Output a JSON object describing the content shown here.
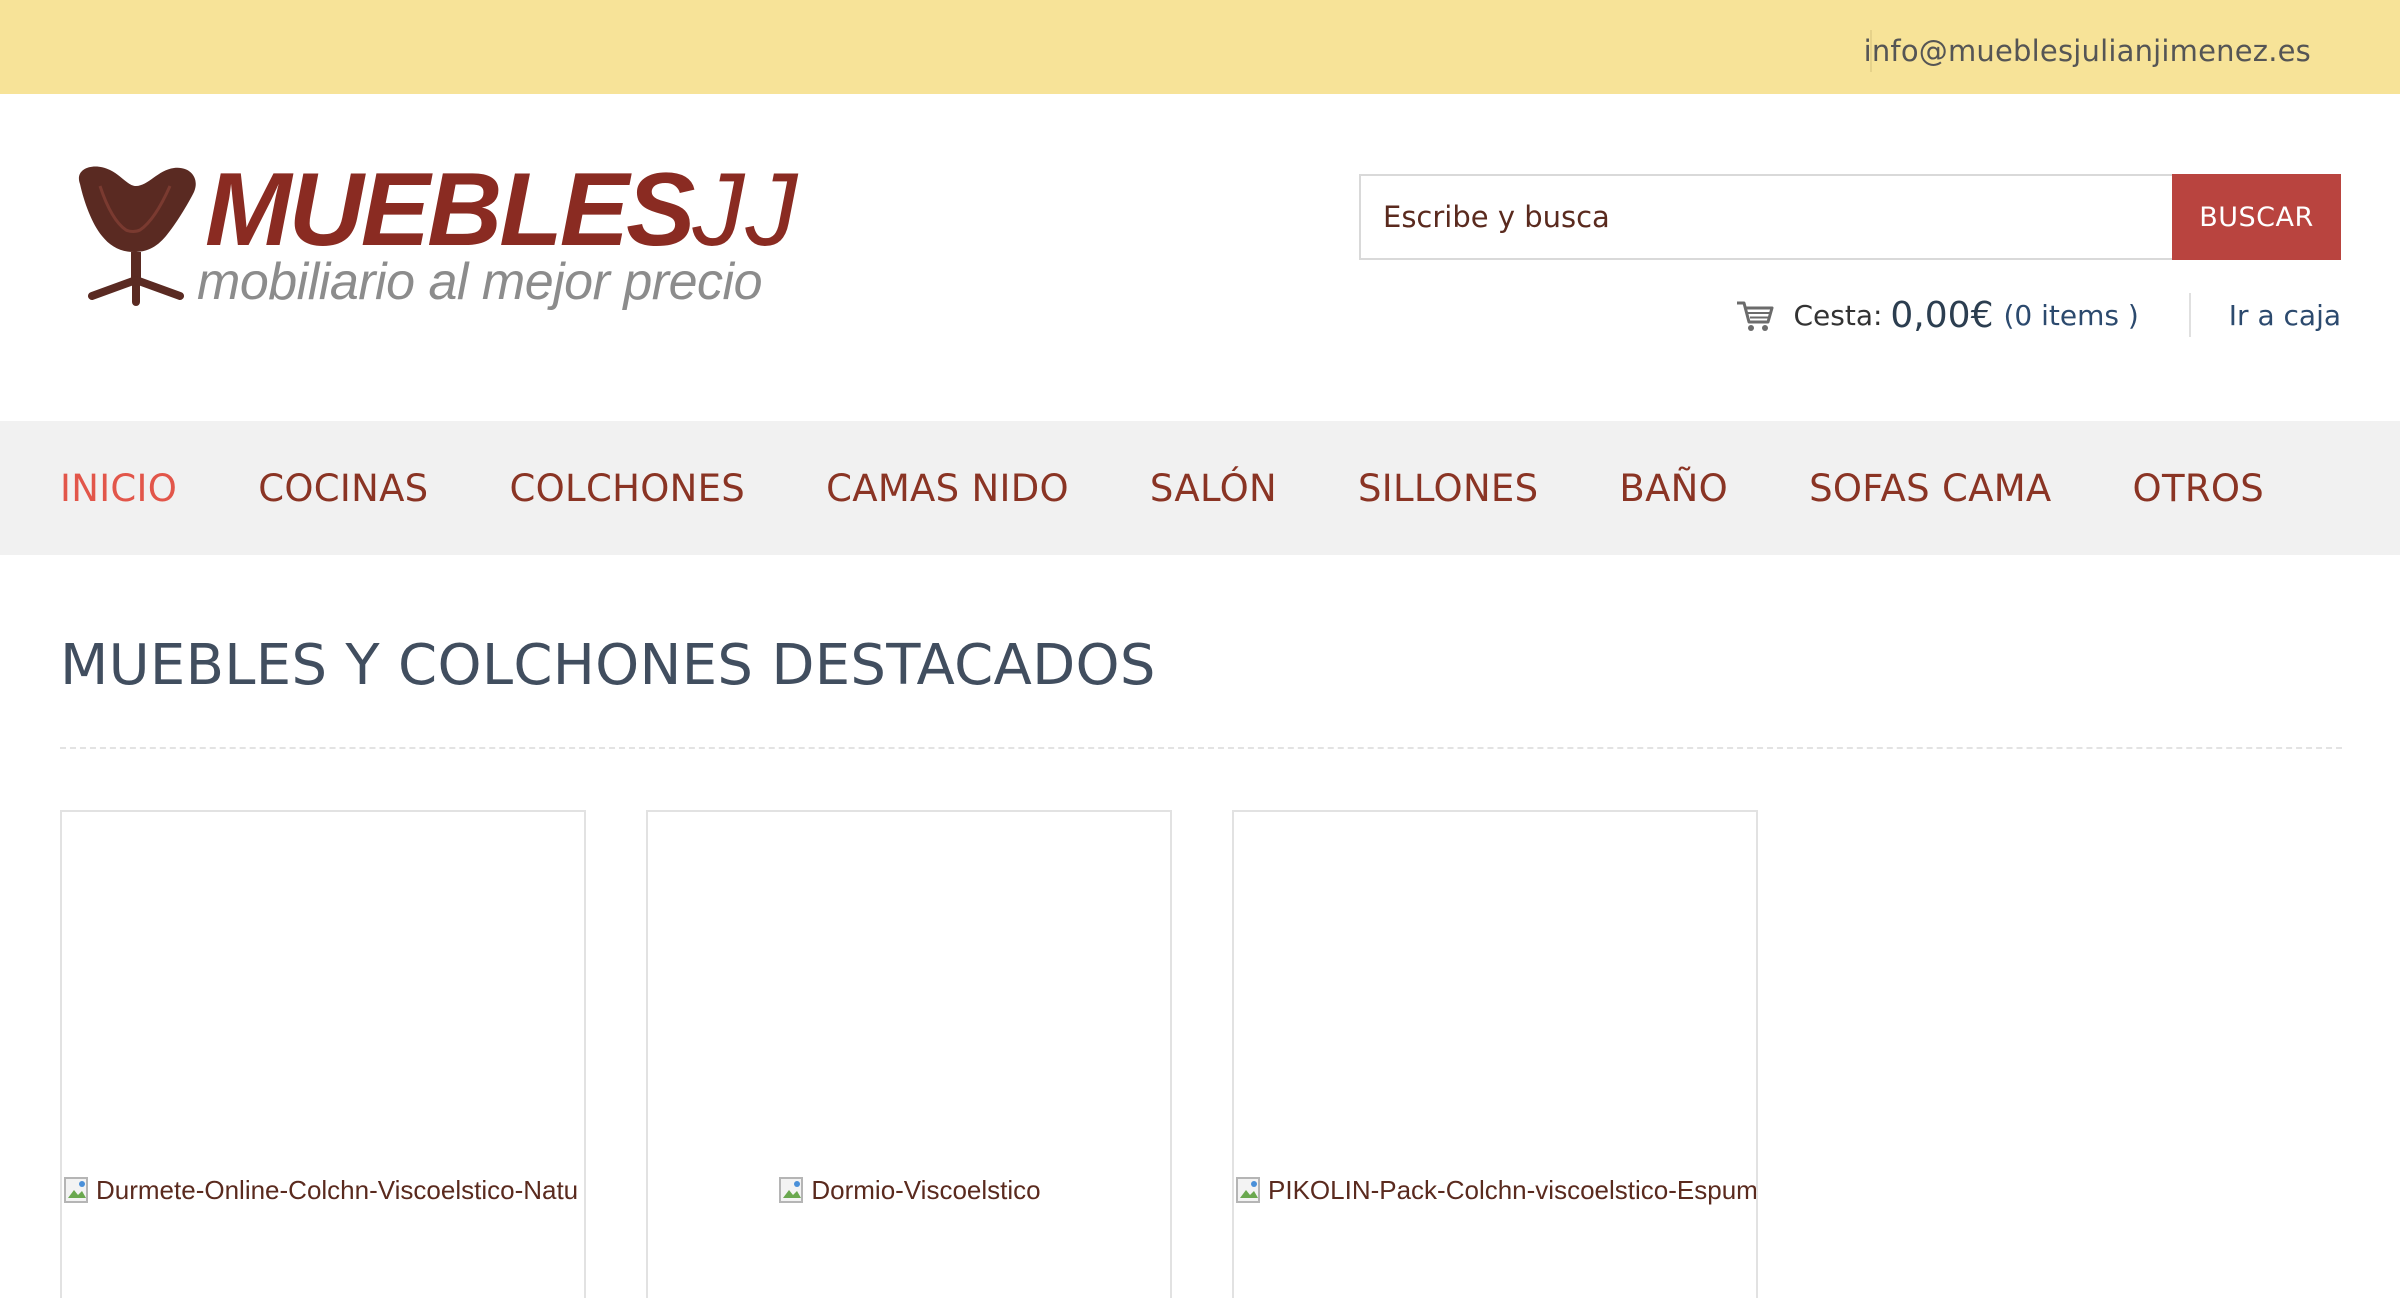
{
  "topbar": {
    "email": "info@mueblesjulianjimenez.es"
  },
  "logo": {
    "brand": "MUEBLES",
    "brand_suffix": "JJ",
    "tagline": "mobiliario al mejor precio",
    "icon": "swan-chair-icon"
  },
  "search": {
    "placeholder": "Escribe y busca",
    "button_label": "BUSCAR"
  },
  "cart": {
    "icon": "cart-icon",
    "label": "Cesta:",
    "amount": "0,00€",
    "items": "(0 items )",
    "checkout_label": "Ir a caja"
  },
  "nav": {
    "items": [
      {
        "label": "INICIO",
        "active": true
      },
      {
        "label": "COCINAS"
      },
      {
        "label": "COLCHONES"
      },
      {
        "label": "CAMAS NIDO"
      },
      {
        "label": "SALÓN"
      },
      {
        "label": "SILLONES"
      },
      {
        "label": "BAÑO"
      },
      {
        "label": "SOFAS CAMA"
      },
      {
        "label": "OTROS"
      }
    ]
  },
  "main": {
    "title": "MUEBLES Y COLCHONES DESTACADOS",
    "products": [
      {
        "alt": "Durmete-Online-Colchn-Viscoelstico-Natu"
      },
      {
        "alt": "Dormio-Viscoelstico"
      },
      {
        "alt": "PIKOLIN-Pack-Colchn-viscoelstico-Espum"
      }
    ]
  },
  "colors": {
    "topbar": "#f7e398",
    "brand": "#8a2b22",
    "button": "#b9443f",
    "nav_bg": "#f1f1f1",
    "nav_active": "#e2564a",
    "nav_text": "#8a3424",
    "heading": "#414e5f"
  }
}
